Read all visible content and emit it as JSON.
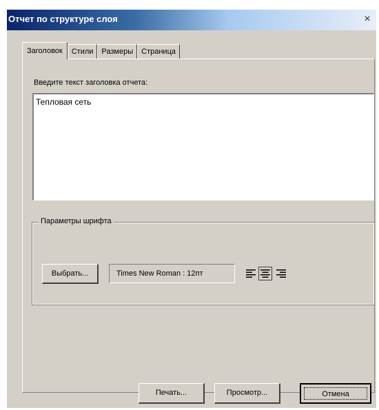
{
  "window": {
    "title": "Отчет по структуре слоя",
    "close_glyph": "×"
  },
  "tabs": [
    {
      "label": "Заголовок",
      "active": true
    },
    {
      "label": "Стили",
      "active": false
    },
    {
      "label": "Размеры",
      "active": false
    },
    {
      "label": "Страница",
      "active": false
    }
  ],
  "header_tab": {
    "prompt": "Введите текст заголовка отчета:",
    "header_text": "Тепловая сеть"
  },
  "font_group": {
    "legend": "Параметры шрифта",
    "choose_label": "Выбрать...",
    "font_value": "Times New Roman : 12пт",
    "alignment_options": [
      "align-left-icon",
      "align-center-icon",
      "align-right-icon"
    ],
    "selected_alignment": "align-center-icon"
  },
  "buttons": {
    "print": "Печать...",
    "preview": "Просмотр...",
    "cancel": "Отмена"
  },
  "colors": {
    "titlebar_start": "#0a246a",
    "dialog_face": "#d4d0c8"
  }
}
